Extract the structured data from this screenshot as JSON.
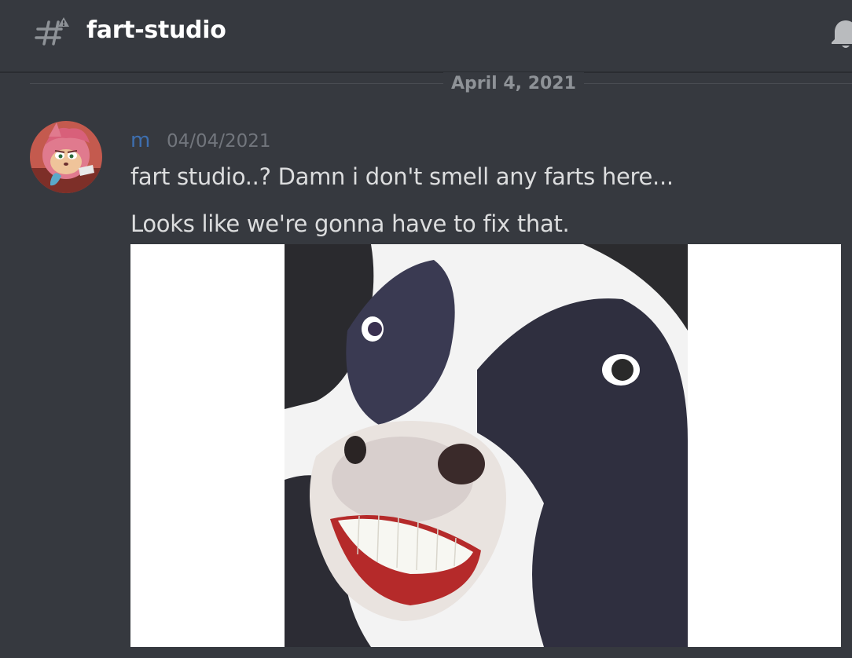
{
  "header": {
    "channel_name": "fart-studio",
    "channel_icon": "text-channel-rules-icon",
    "bell_icon": "bell-icon"
  },
  "divider": {
    "date": "April 4, 2021"
  },
  "message": {
    "author": "m",
    "timestamp": "04/04/2021",
    "lines": [
      "fart studio..? Damn i don't smell any farts here...",
      "Looks like we're gonna have to fix that."
    ],
    "avatar_icon": "pink-hedgehog-avatar",
    "attachment_icon": "smiling-cow-image"
  },
  "colors": {
    "background": "#36393f",
    "header_text": "#ffffff",
    "message_text": "#dcddde",
    "muted_text": "#72767d",
    "author_color": "#3e6fb0"
  }
}
